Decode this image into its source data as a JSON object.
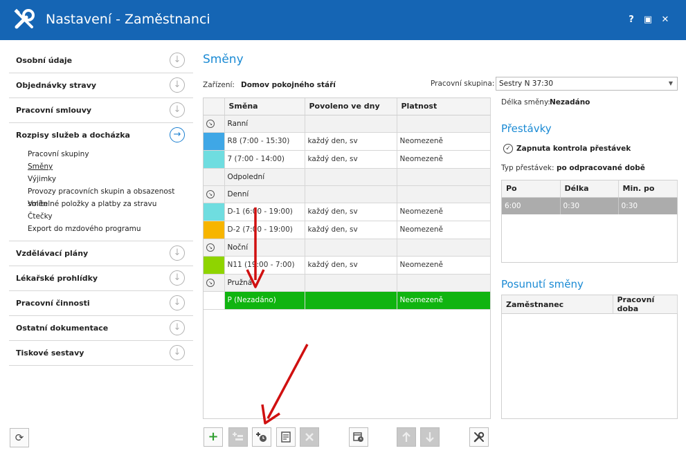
{
  "window": {
    "title": "Nastavení - Zaměstnanci",
    "help_label": "?",
    "maximize_label": "▣",
    "close_label": "✕"
  },
  "sidebar": {
    "items_top": [
      {
        "label": "Osobní údaje"
      },
      {
        "label": "Objednávky stravy"
      },
      {
        "label": "Pracovní smlouvy"
      }
    ],
    "active": {
      "label": "Rozpisy služeb a docházka",
      "subitems": [
        "Pracovní skupiny",
        "Směny",
        "Výjimky",
        "Provozy pracovních skupin a obsazenost směn",
        "Volitelné položky a platby za stravu",
        "Čtečky",
        "Export do mzdového programu"
      ]
    },
    "items_bottom": [
      {
        "label": "Vzdělávací plány"
      },
      {
        "label": "Lékařské prohlídky"
      },
      {
        "label": "Pracovní činnosti"
      },
      {
        "label": "Ostatní dokumentace"
      },
      {
        "label": "Tiskové sestavy"
      }
    ]
  },
  "main": {
    "heading": "Směny",
    "zarizeni_label": "Zařízení:",
    "zarizeni_value": "Domov pokojného stáří",
    "pracovni_skupina_label": "Pracovní skupina:",
    "pracovni_skupina_value": "Sestry N 37:30",
    "grid": {
      "columns": [
        "Směna",
        "Povoleno ve dny",
        "Platnost"
      ],
      "rows": [
        {
          "type": "group",
          "name": "Ranní",
          "expander": true
        },
        {
          "type": "shift",
          "color": "#3fa7e6",
          "name": "R8 (7:00 - 15:30)",
          "days": "každý den, sv",
          "validity": "Neomezeně"
        },
        {
          "type": "shift",
          "color": "#6fdde0",
          "name": "7 (7:00 - 14:00)",
          "days": "každý den, sv",
          "validity": "Neomezeně"
        },
        {
          "type": "group",
          "name": "Odpolední",
          "expander": false
        },
        {
          "type": "group",
          "name": "Denní",
          "expander": true
        },
        {
          "type": "shift",
          "color": "#6fdde0",
          "name": "D-1 (6:00 - 19:00)",
          "days": "každý den, sv",
          "validity": "Neomezeně"
        },
        {
          "type": "shift",
          "color": "#f7b500",
          "name": "D-2 (7:00 - 19:00)",
          "days": "každý den, sv",
          "validity": "Neomezeně"
        },
        {
          "type": "group",
          "name": "Noční",
          "expander": true
        },
        {
          "type": "shift",
          "color": "#8fd400",
          "name": "N11 (19:00 - 7:00)",
          "days": "každý den, sv",
          "validity": "Neomezeně"
        },
        {
          "type": "group",
          "name": "Pružná",
          "expander": true
        },
        {
          "type": "selected",
          "color": "#ffffff",
          "name": "P (Nezadáno)",
          "days": "",
          "validity": "Neomezeně"
        }
      ]
    }
  },
  "right": {
    "delka_label": "Délka směny:",
    "delka_value": "Nezadáno",
    "prestavky_heading": "Přestávky",
    "kontrola_label": "Zapnuta kontrola přestávek",
    "typ_label": "Typ přestávek:",
    "typ_value": "po odpracované době",
    "prestavky_columns": [
      "Po",
      "Délka",
      "Min. po"
    ],
    "prestavky_row": [
      "6:00",
      "0:30",
      "0:30"
    ],
    "posunuti_heading": "Posunutí směny",
    "posunuti_columns": [
      "Zaměstnanec",
      "Pracovní doba"
    ]
  },
  "toolbar": {
    "add_label": "+",
    "refresh_label": "⟳"
  },
  "colors": {
    "titlebar": "#1565b4",
    "accent": "#1a8ad4",
    "selected_row": "#10b410",
    "annotation_arrow": "#d01010"
  }
}
